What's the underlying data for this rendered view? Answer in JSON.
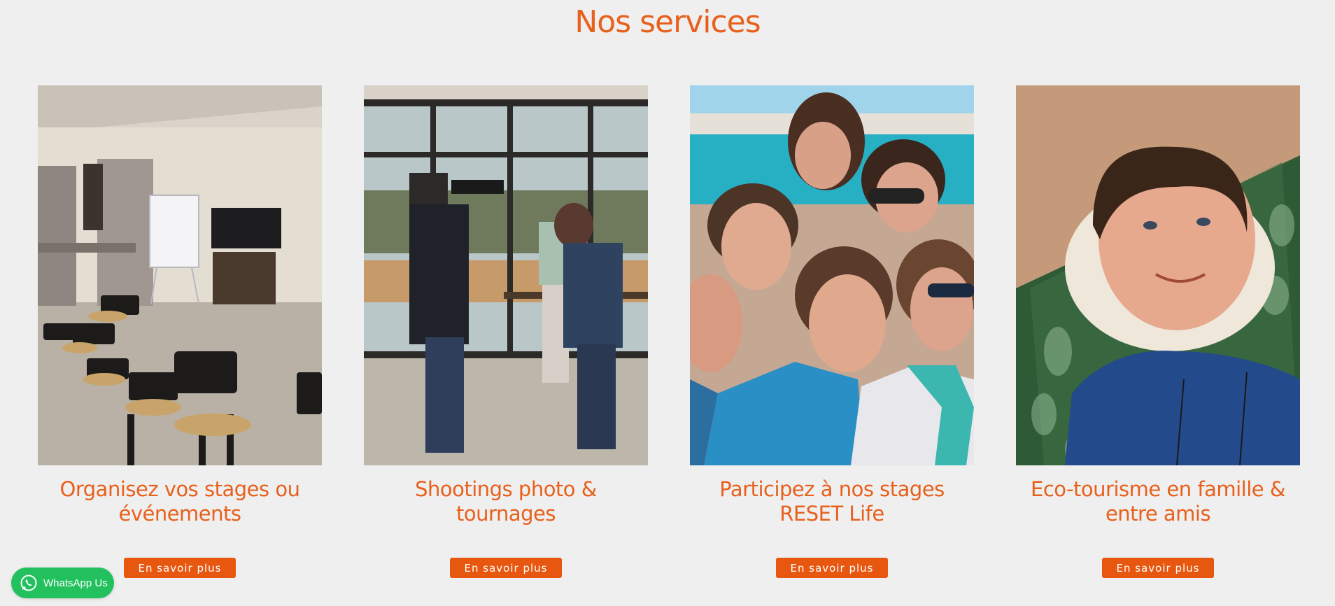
{
  "section": {
    "title": "Nos services"
  },
  "services": [
    {
      "title_line1": "Organisez vos stages ou",
      "title_line2": "événements",
      "button_label": "En savoir plus",
      "image": "meeting-room-photo"
    },
    {
      "title_line1": "Shootings photo &",
      "title_line2": "tournages",
      "button_label": "En savoir plus",
      "image": "film-shooting-photo"
    },
    {
      "title_line1": "Participez à nos stages",
      "title_line2": "RESET Life",
      "button_label": "En savoir plus",
      "image": "group-selfie-beach-photo"
    },
    {
      "title_line1": "Eco-tourisme en famille &",
      "title_line2": "entre amis",
      "button_label": "En savoir plus",
      "image": "child-lying-on-mat-photo"
    }
  ],
  "whatsapp": {
    "label": "WhatsApp Us",
    "icon": "whatsapp-icon",
    "color": "#22c15e"
  },
  "colors": {
    "accent": "#e8601c",
    "button": "#e8570f",
    "background": "#efefef"
  }
}
